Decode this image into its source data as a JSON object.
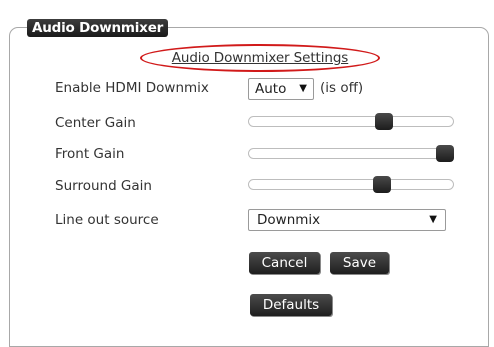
{
  "legend": "Audio Downmixer",
  "settings_link": "Audio Downmixer Settings",
  "highlight_color": "#d11a1a",
  "rows": {
    "hdmi": {
      "label": "Enable HDMI Downmix",
      "select_value": "Auto",
      "status": "(is off)"
    },
    "center": {
      "label": "Center Gain",
      "level": 0.66
    },
    "front": {
      "label": "Front Gain",
      "level": 0.96
    },
    "surround": {
      "label": "Surround Gain",
      "level": 0.65
    },
    "lineout": {
      "label": "Line out source",
      "select_value": "Downmix"
    }
  },
  "buttons": {
    "cancel": "Cancel",
    "save": "Save",
    "defaults": "Defaults"
  },
  "icons": {
    "dropdown": "▼"
  }
}
